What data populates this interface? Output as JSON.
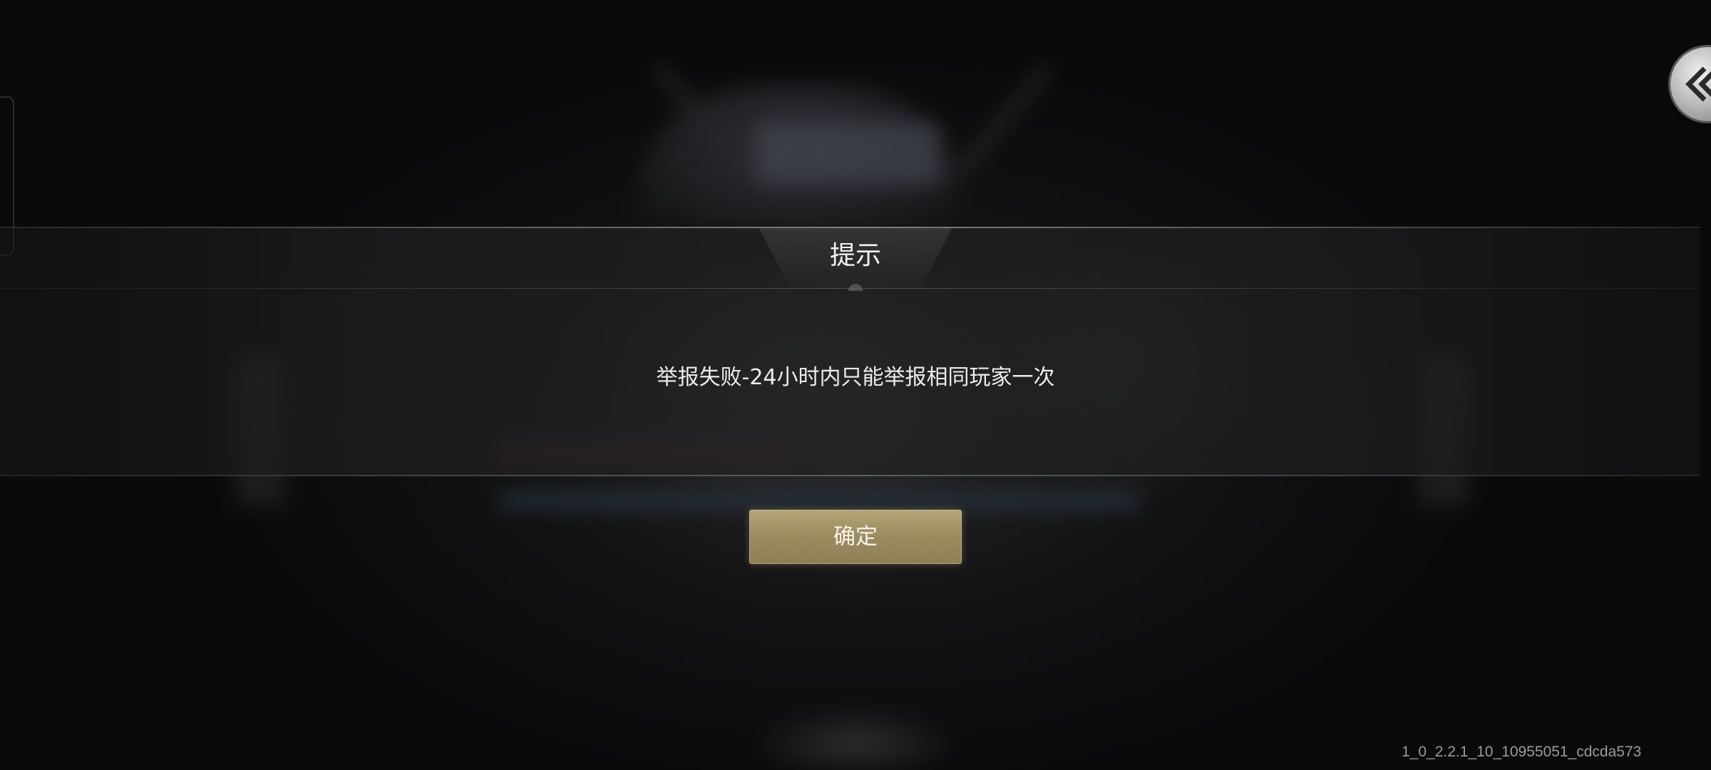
{
  "dialog": {
    "title": "提示",
    "message": "举报失败-24小时内只能举报相同玩家一次",
    "confirm_label": "确定"
  },
  "navigation": {
    "back_icon": "double-chevron-left-icon"
  },
  "footer": {
    "version": "1_0_2.2.1_10_10955051_cdcda573"
  },
  "colors": {
    "button_gold": "#a8976a",
    "text_light": "#f2f2f2",
    "background": "#0c0c0d"
  }
}
